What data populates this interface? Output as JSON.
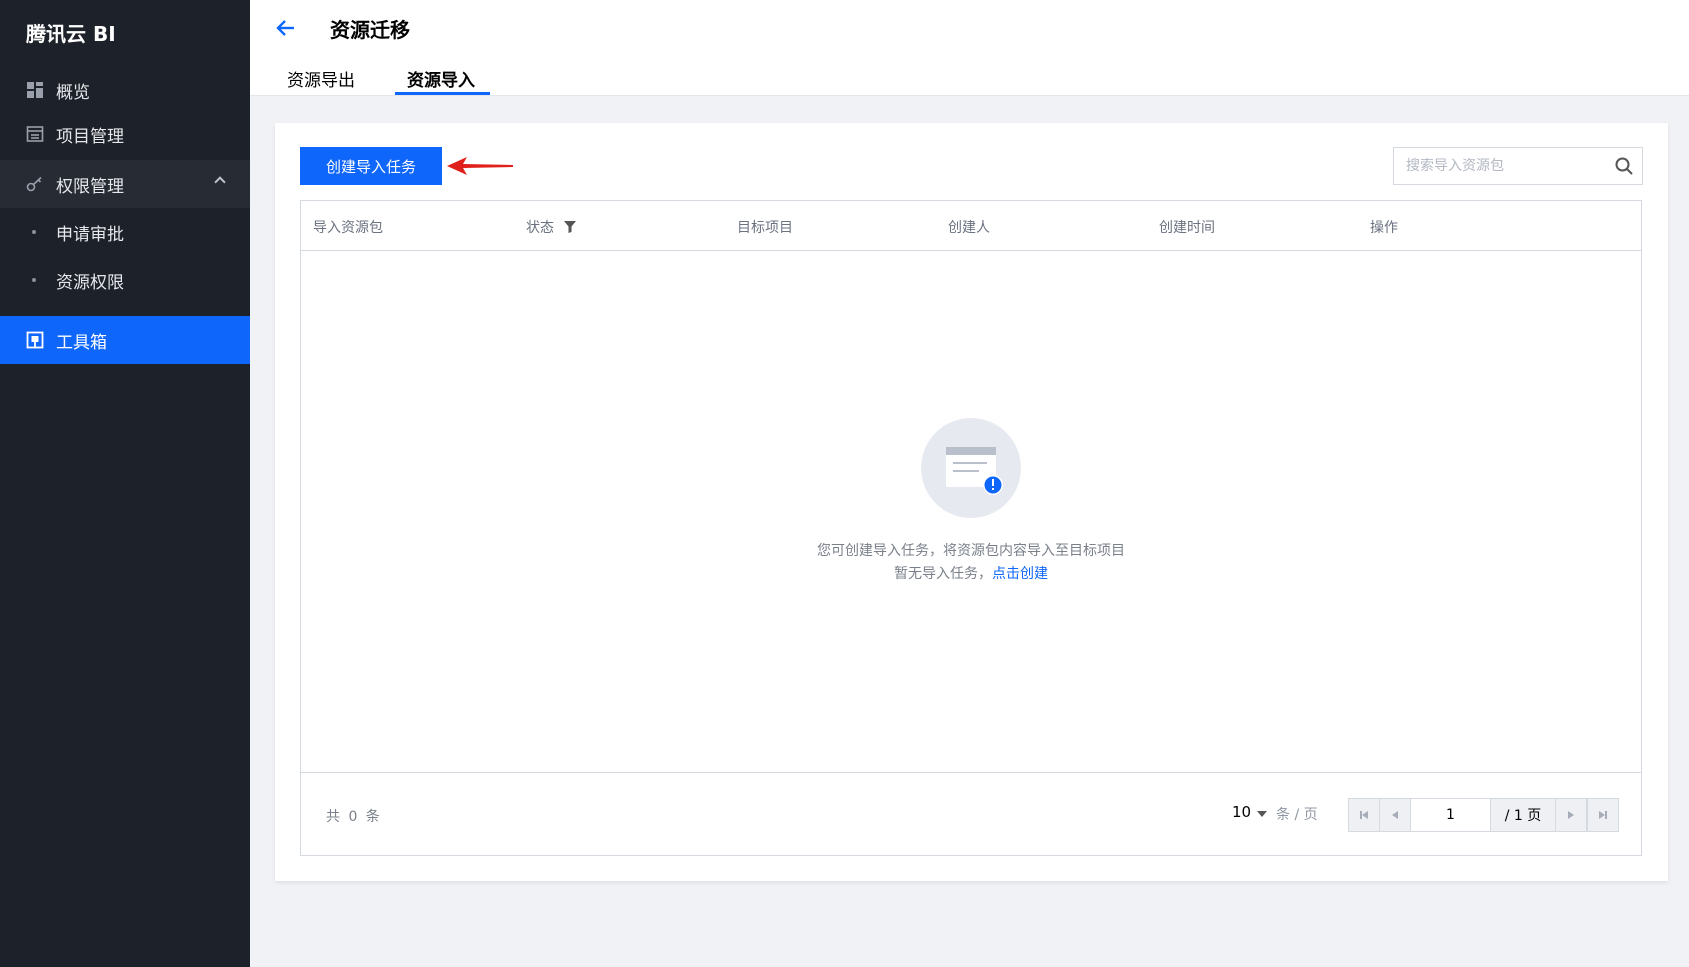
{
  "app": {
    "brand": "腾讯云 BI"
  },
  "sidebar": {
    "items": [
      {
        "label": "概览",
        "icon": "dashboard-grid-icon"
      },
      {
        "label": "项目管理",
        "icon": "project-icon"
      },
      {
        "label": "权限管理",
        "icon": "key-icon",
        "expanded": true
      },
      {
        "label": "申请审批",
        "sub": true
      },
      {
        "label": "资源权限",
        "sub": true
      },
      {
        "label": "工具箱",
        "icon": "toolbox-icon",
        "active": true
      }
    ]
  },
  "header": {
    "title": "资源迁移",
    "tabs": [
      {
        "label": "资源导出",
        "active": false
      },
      {
        "label": "资源导入",
        "active": true
      }
    ]
  },
  "toolbar": {
    "create_label": "创建导入任务",
    "search_placeholder": "搜索导入资源包"
  },
  "table": {
    "columns": [
      "导入资源包",
      "状态",
      "目标项目",
      "创建人",
      "创建时间",
      "操作"
    ],
    "rows": []
  },
  "empty": {
    "line1": "您可创建导入任务，将资源包内容导入至目标项目",
    "line2_prefix": "暂无导入任务，",
    "line2_link": "点击创建"
  },
  "pagination": {
    "total": "共 0 条",
    "page_size": "10",
    "per_page": "条 / 页",
    "current_page": "1",
    "total_pages": "/ 1 页"
  },
  "colors": {
    "sidebar_bg": "#1d2129",
    "accent": "#0f66fa",
    "annotation_arrow": "#e0201b"
  }
}
